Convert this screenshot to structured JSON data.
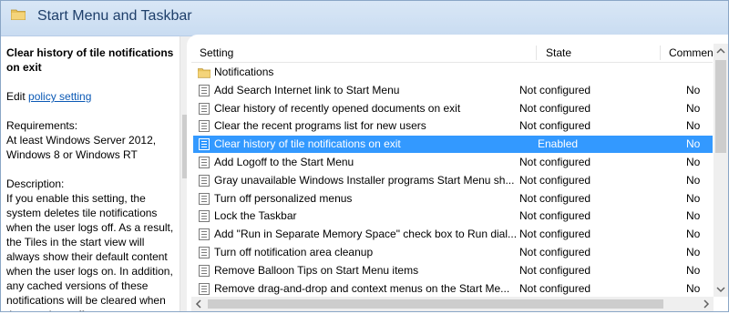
{
  "header": {
    "title": "Start Menu and Taskbar"
  },
  "left": {
    "policy_title": "Clear history of tile notifications on exit",
    "edit_prefix": "Edit",
    "edit_link": "policy setting",
    "requirements_label": "Requirements:",
    "requirements_text": "At least Windows Server 2012, Windows 8 or Windows RT",
    "description_label": "Description:",
    "description_text": "If you enable this setting, the system deletes tile notifications when the user logs off. As a result, the Tiles in the start view will always show their default content when the user logs on. In addition, any cached versions of these notifications will be cleared when the user logs off."
  },
  "columns": {
    "setting": "Setting",
    "state": "State",
    "comment": "Commen"
  },
  "folder_row": {
    "name": "Notifications"
  },
  "rows": [
    {
      "name": "Add Search Internet link to Start Menu",
      "state": "Not configured",
      "comment": "No"
    },
    {
      "name": "Clear history of recently opened documents on exit",
      "state": "Not configured",
      "comment": "No"
    },
    {
      "name": "Clear the recent programs list for new users",
      "state": "Not configured",
      "comment": "No"
    },
    {
      "name": "Clear history of tile notifications on exit",
      "state": "Enabled",
      "comment": "No",
      "selected": true
    },
    {
      "name": "Add Logoff to the Start Menu",
      "state": "Not configured",
      "comment": "No"
    },
    {
      "name": "Gray unavailable Windows Installer programs Start Menu sh...",
      "state": "Not configured",
      "comment": "No"
    },
    {
      "name": "Turn off personalized menus",
      "state": "Not configured",
      "comment": "No"
    },
    {
      "name": "Lock the Taskbar",
      "state": "Not configured",
      "comment": "No"
    },
    {
      "name": "Add \"Run in Separate Memory Space\" check box to Run dial...",
      "state": "Not configured",
      "comment": "No"
    },
    {
      "name": "Turn off notification area cleanup",
      "state": "Not configured",
      "comment": "No"
    },
    {
      "name": "Remove Balloon Tips on Start Menu items",
      "state": "Not configured",
      "comment": "No"
    },
    {
      "name": "Remove drag-and-drop and context menus on the Start Me...",
      "state": "Not configured",
      "comment": "No"
    }
  ],
  "colors": {
    "header_bg": "#c9dcf1",
    "selection": "#3399ff",
    "link": "#0b59b5"
  }
}
